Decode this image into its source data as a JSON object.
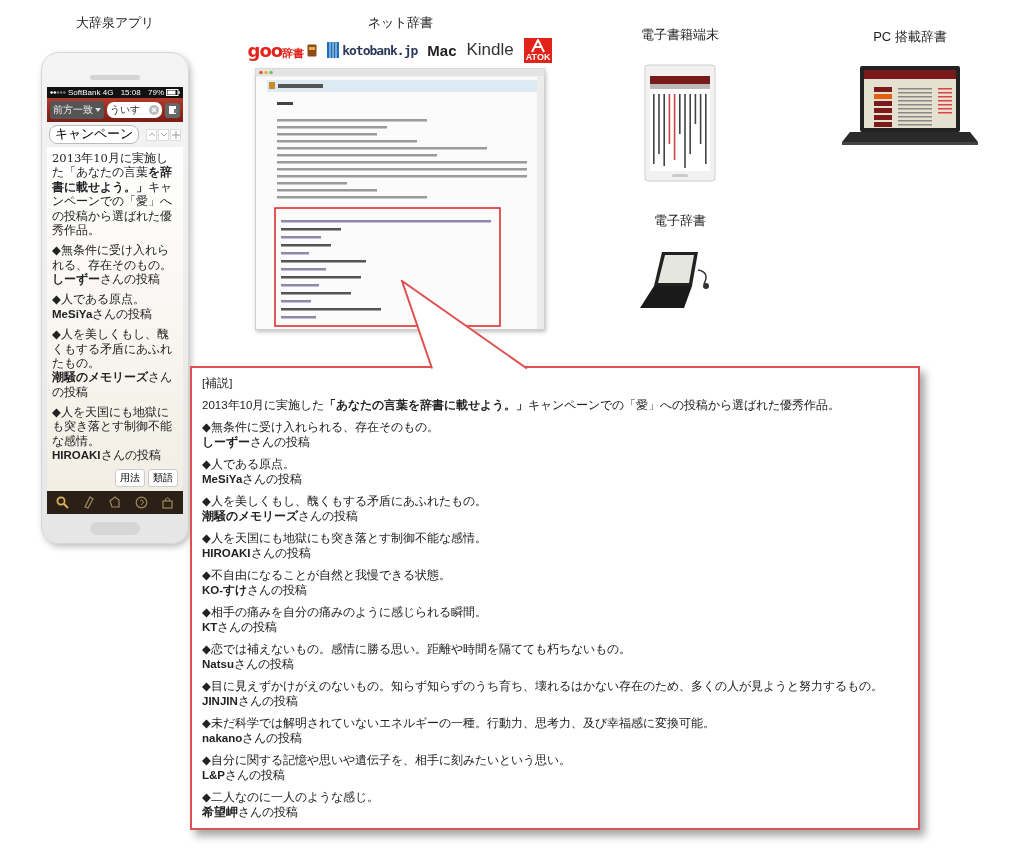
{
  "phone_app": {
    "title": "大辞泉アプリ",
    "status": {
      "carrier": "SoftBank 4G",
      "time": "15:08",
      "battery": "79%"
    },
    "search": {
      "mode": "前方一致",
      "value": "ういす"
    },
    "back_button": "キャンペーン",
    "intro": "2013年10月に実施した「あなたの言葉**を辞書に載せよう。」**キャンペーンでの「愛」への投稿から選ばれた優秀作品。",
    "entries": [
      {
        "quote": "◆無条件に受け入れられる、存在そのもの。",
        "credit": "**しーずー**さんの投稿"
      },
      {
        "quote": "◆人である原点。",
        "credit": "**MeSiYa**さんの投稿"
      },
      {
        "quote": "◆人を美しくもし、醜くもする矛盾にあふれたもの。",
        "credit": "**潮騒のメモリーズ**さんの投稿"
      },
      {
        "quote": "◆人を天国にも地獄にも突き落とす制御不能な感情。",
        "credit": "**HIROAKI**さんの投稿"
      }
    ],
    "buttons": [
      "用法",
      "類語"
    ]
  },
  "web_dictionary": {
    "title": "ネット辞書",
    "logos": [
      {
        "kind": "goo",
        "text": "goo",
        "sub": "辞書"
      },
      {
        "kind": "kotobank",
        "text": "kotobank.jp"
      },
      {
        "kind": "bold",
        "text": "Mac"
      },
      {
        "kind": "light",
        "text": "Kindle"
      },
      {
        "kind": "atok",
        "text": "ATOK"
      }
    ]
  },
  "ebook_reader": {
    "title": "電子書籍端末"
  },
  "electronic_dictionary": {
    "title": "電子辞書"
  },
  "pc_dictionary": {
    "title": "PC 搭載辞書"
  },
  "callout": {
    "heading": "[補説]",
    "intro": "2013年10月に実施した**「あなたの言葉を辞書に載せよう。」**キャンペーンでの「愛」への投稿から選ばれた優秀作品。",
    "entries": [
      {
        "quote": "◆無条件に受け入れられる、存在そのもの。",
        "credit": "**しーずー**さんの投稿"
      },
      {
        "quote": "◆人である原点。",
        "credit": "**MeSiYa**さんの投稿"
      },
      {
        "quote": "◆人を美しくもし、醜くもする矛盾にあふれたもの。",
        "credit": "**潮騒のメモリーズ**さんの投稿"
      },
      {
        "quote": "◆人を天国にも地獄にも突き落とす制御不能な感情。",
        "credit": "**HIROAKI**さんの投稿"
      },
      {
        "quote": "◆不自由になることが自然と我慢できる状態。",
        "credit": "**KO-すけ**さんの投稿"
      },
      {
        "quote": "◆相手の痛みを自分の痛みのように感じられる瞬間。",
        "credit": "**KT**さんの投稿"
      },
      {
        "quote": "◆恋では補えないもの。感情に勝る思い。距離や時間を隔てても朽ちないもの。",
        "credit": "**Natsu**さんの投稿"
      },
      {
        "quote": "◆目に見えずかけがえのないもの。知らず知らずのうち育ち、壊れるはかない存在のため、多くの人が見ようと努力するもの。",
        "credit": "**JINJIN**さんの投稿"
      },
      {
        "quote": "◆未だ科学では解明されていないエネルギーの一種。行動力、思考力、及び幸福感に変換可能。",
        "credit": "**nakano**さんの投稿"
      },
      {
        "quote": "◆自分に関する記憶や思いや遺伝子を、相手に刻みたいという思い。",
        "credit": "**L&P**さんの投稿"
      },
      {
        "quote": "◆二人なのに一人のような感じ。",
        "credit": "**希望岬**さんの投稿"
      }
    ]
  }
}
